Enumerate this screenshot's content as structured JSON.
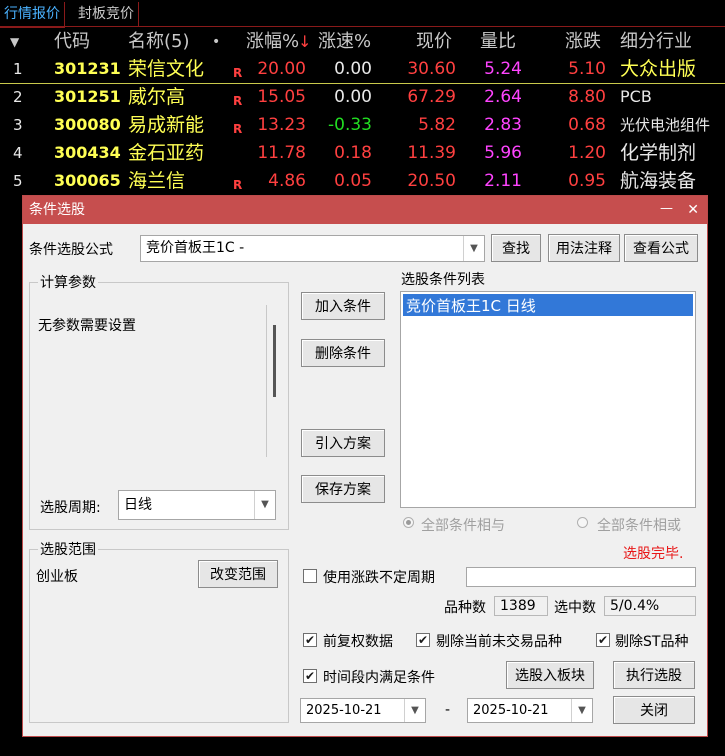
{
  "tabs": [
    "行情报价",
    "封板竞价"
  ],
  "headers": {
    "arrow": "▼",
    "code": "代码",
    "name": "名称(5)",
    "dot": "•",
    "change_pct": "涨幅%",
    "sort_arrow": "↓",
    "speed": "涨速%",
    "price": "现价",
    "vol_ratio": "量比",
    "change": "涨跌",
    "industry": "细分行业"
  },
  "rows": [
    {
      "idx": "1",
      "code": "301231",
      "name": "荣信文化",
      "flag": "R",
      "change_pct": "20.00",
      "speed": "0.00",
      "price": "30.60",
      "vol_ratio": "5.24",
      "change": "5.10",
      "industry": "大众出版"
    },
    {
      "idx": "2",
      "code": "301251",
      "name": "威尔高",
      "flag": "R",
      "change_pct": "15.05",
      "speed": "0.00",
      "price": "67.29",
      "vol_ratio": "2.64",
      "change": "8.80",
      "industry": "PCB"
    },
    {
      "idx": "3",
      "code": "300080",
      "name": "易成新能",
      "flag": "R",
      "change_pct": "13.23",
      "speed": "-0.33",
      "price": "5.82",
      "vol_ratio": "2.83",
      "change": "0.68",
      "industry": "光伏电池组件"
    },
    {
      "idx": "4",
      "code": "300434",
      "name": "金石亚药",
      "flag": "",
      "change_pct": "11.78",
      "speed": "0.18",
      "price": "11.39",
      "vol_ratio": "5.96",
      "change": "1.20",
      "industry": "化学制剂"
    },
    {
      "idx": "5",
      "code": "300065",
      "name": "海兰信",
      "flag": "R",
      "change_pct": "4.86",
      "speed": "0.05",
      "price": "20.50",
      "vol_ratio": "2.11",
      "change": "0.95",
      "industry": "航海装备"
    }
  ],
  "colors": {
    "yellow": "#ffff54",
    "red": "#ff4040",
    "green": "#22dd22",
    "magenta": "#ff44ff",
    "white": "#e8e8e8"
  },
  "dialog": {
    "title": "条件选股",
    "min_icon": "—",
    "close_icon": "✕",
    "formula_label": "条件选股公式",
    "formula_value": "竞价首板王1C  -",
    "find": "查找",
    "usage": "用法注释",
    "view_formula": "查看公式",
    "params_title": "计算参数",
    "params_text": "无参数需要设置",
    "period_label": "选股周期:",
    "period_value": "日线",
    "add_cond": "加入条件",
    "del_cond": "删除条件",
    "import_plan": "引入方案",
    "save_plan": "保存方案",
    "cond_list_title": "选股条件列表",
    "cond_items": [
      "竞价首板王1C  日线"
    ],
    "all_and": "全部条件相与",
    "all_or": "全部条件相或",
    "status": "选股完毕.",
    "scope_title": "选股范围",
    "scope_value": "创业板",
    "change_scope": "改变范围",
    "use_period": "使用涨跌不定周期",
    "count_label": "品种数",
    "count_value": "1389",
    "selected_label": "选中数",
    "selected_value": "5/0.4%",
    "check_fq": "前复权数据",
    "check_untraded": "剔除当前未交易品种",
    "check_st": "剔除ST品种",
    "check_time": "时间段内满足条件",
    "to_block": "选股入板块",
    "run": "执行选股",
    "date_from": "2025-10-21",
    "date_sep": "-",
    "date_to": "2025-10-21",
    "close": "关闭",
    "check_mark": "✔",
    "dropdown_arrow": "▼"
  }
}
